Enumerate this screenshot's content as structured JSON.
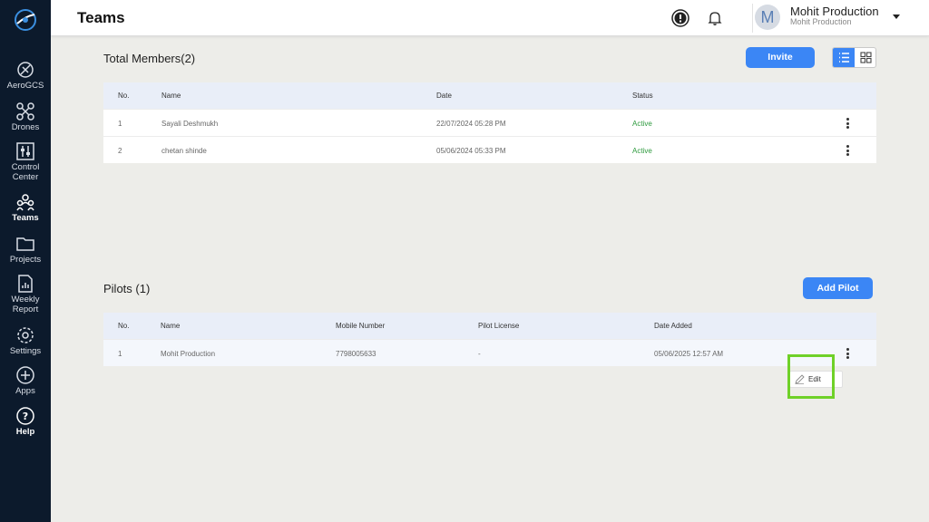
{
  "sidebar": {
    "items": [
      {
        "label": "AeroGCS"
      },
      {
        "label": "Drones"
      },
      {
        "label": "Control Center"
      },
      {
        "label": "Teams"
      },
      {
        "label": "Projects"
      },
      {
        "label": "Weekly Report"
      },
      {
        "label": "Settings"
      },
      {
        "label": "Apps"
      },
      {
        "label": "Help"
      }
    ]
  },
  "header": {
    "title": "Teams",
    "user_initial": "M",
    "user_name": "Mohit Production",
    "user_org": "Mohit Production"
  },
  "members": {
    "title": "Total Members(2)",
    "invite_label": "Invite",
    "columns": [
      "No.",
      "Name",
      "Date",
      "Status"
    ],
    "rows": [
      {
        "no": "1",
        "name": "Sayali Deshmukh",
        "date": "22/07/2024 05:28 PM",
        "status": "Active"
      },
      {
        "no": "2",
        "name": "chetan shinde",
        "date": "05/06/2024 05:33 PM",
        "status": "Active"
      }
    ]
  },
  "pilots": {
    "title": "Pilots (1)",
    "add_label": "Add Pilot",
    "columns": [
      "No.",
      "Name",
      "Mobile Number",
      "Pilot License",
      "Date Added"
    ],
    "rows": [
      {
        "no": "1",
        "name": "Mohit Production",
        "mobile": "7798005633",
        "license": "-",
        "date_added": "05/06/2025 12:57 AM"
      }
    ],
    "menu_edit_label": "Edit"
  },
  "colors": {
    "sidebar_bg": "#0c1a2c",
    "accent": "#3b86f5",
    "status_active": "#2e9a3e",
    "highlight_box": "#6fd128"
  }
}
